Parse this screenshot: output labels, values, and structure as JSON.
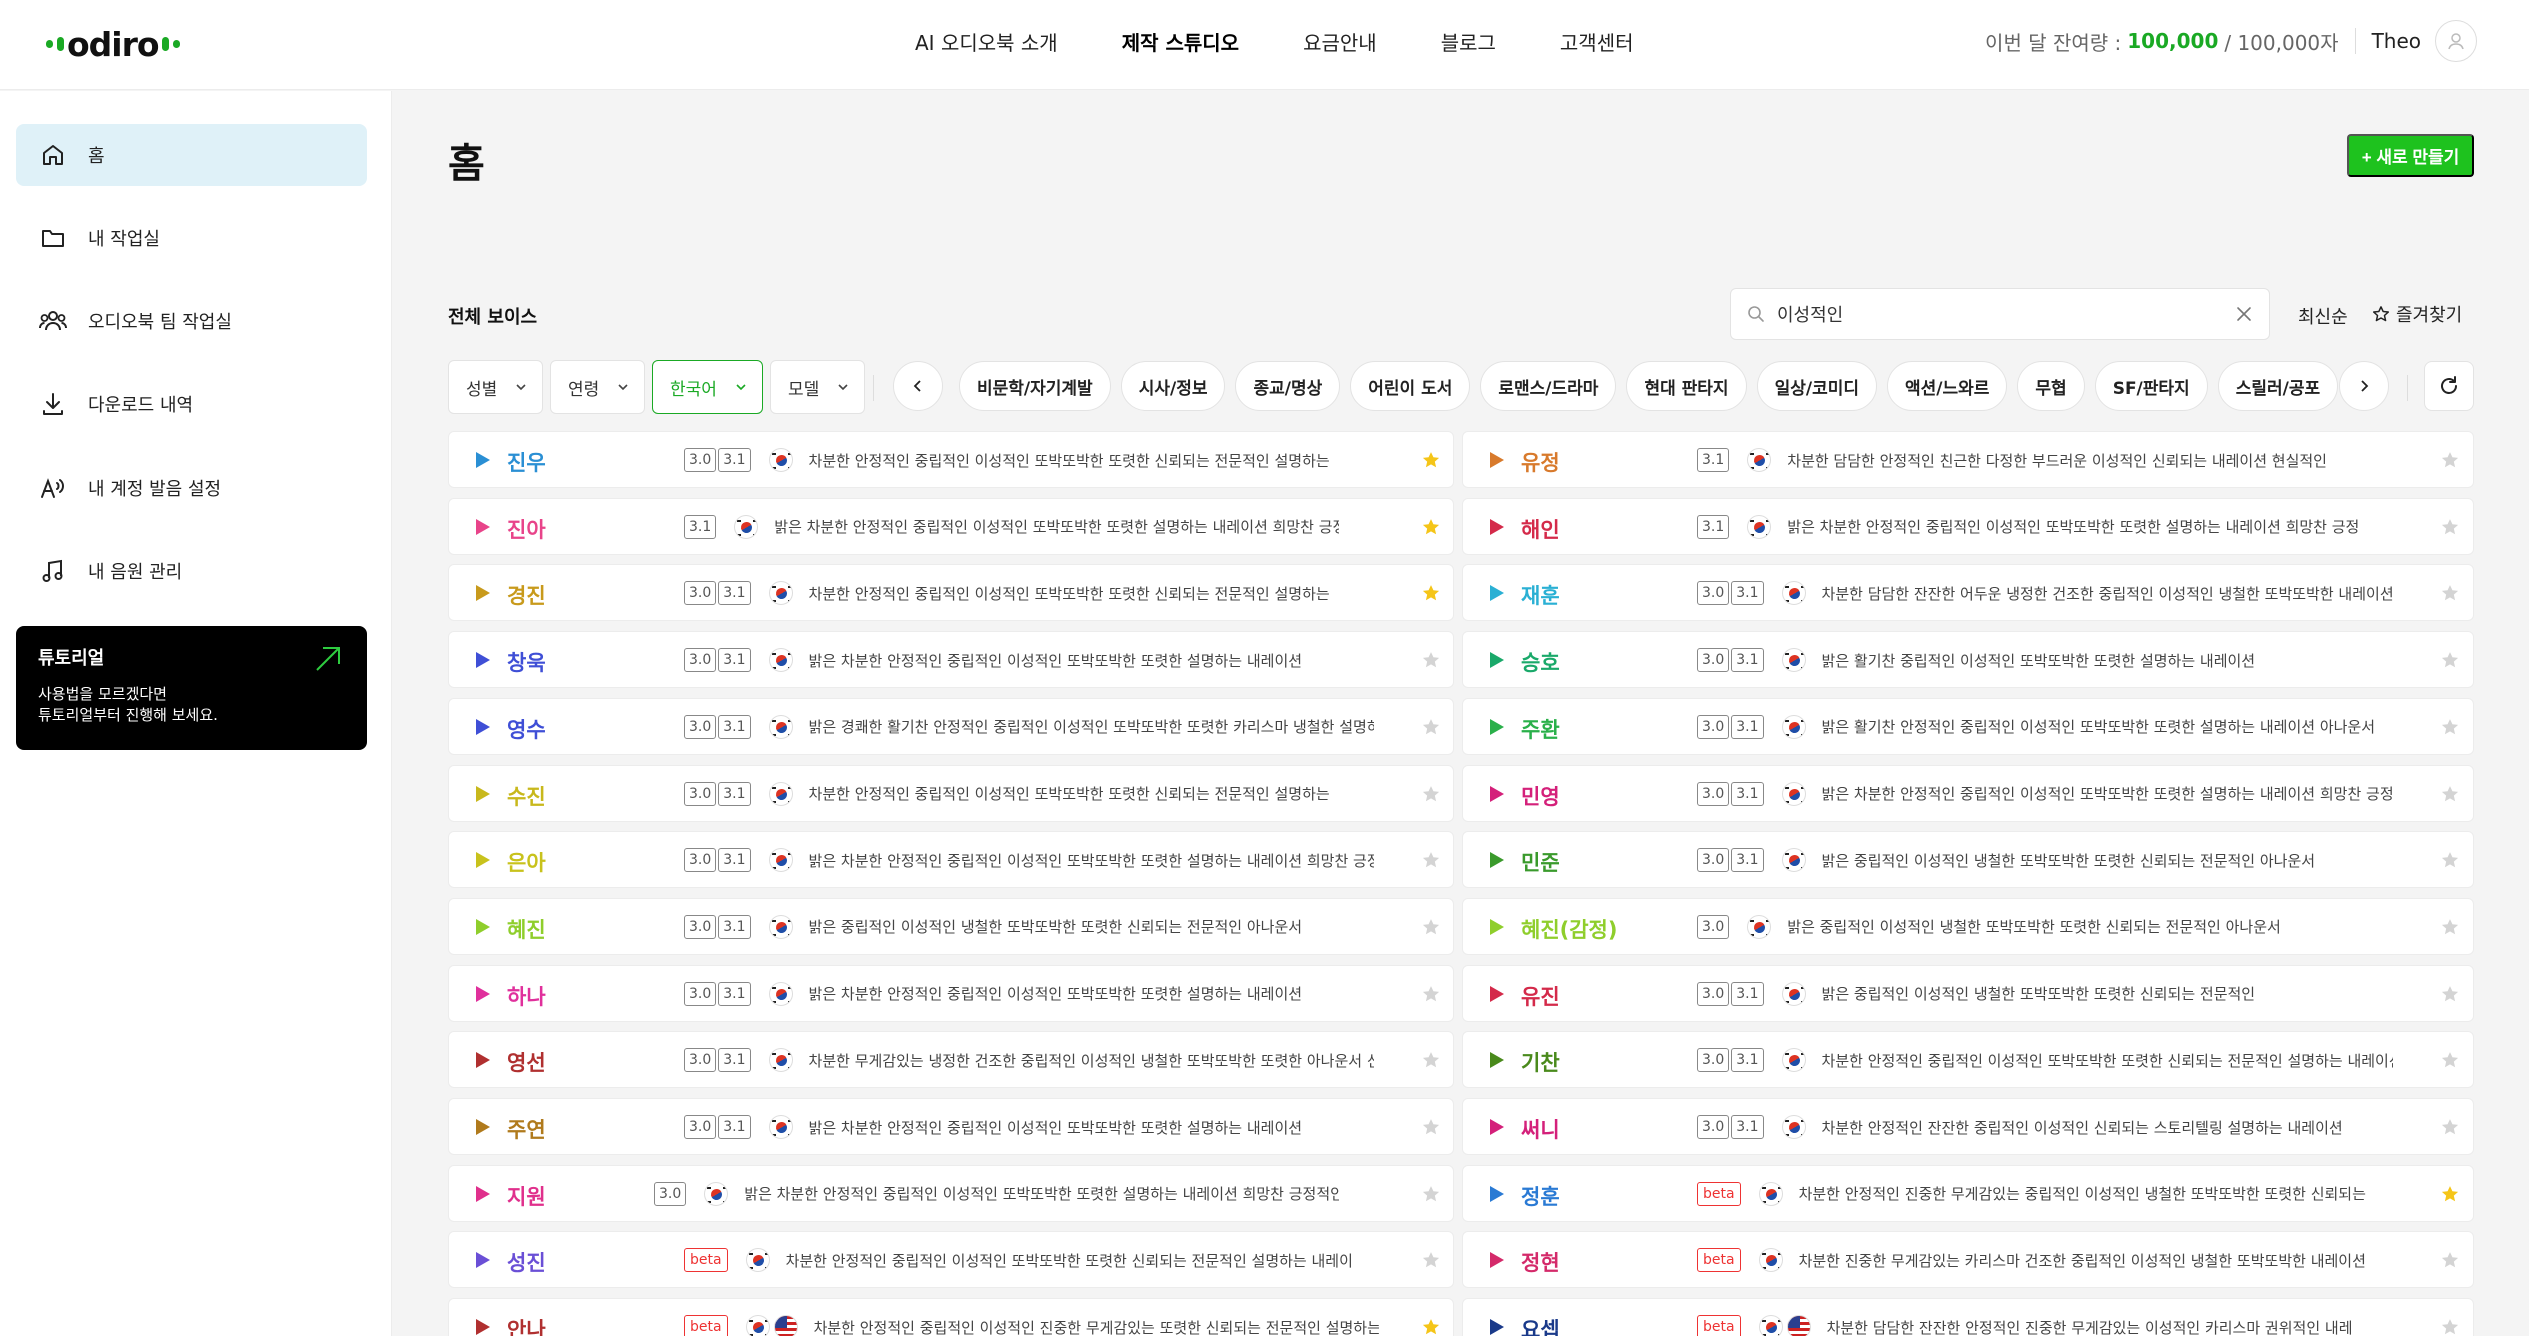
{
  "header": {
    "logo_text": "odiro",
    "nav": [
      "AI 오디오북 소개",
      "제작 스튜디오",
      "요금안내",
      "블로그",
      "고객센터"
    ],
    "active_nav": 1,
    "balance_label": "이번 달 잔여량 :",
    "balance_value": "100,000",
    "balance_total": "/ 100,000자",
    "user_name": "Theo"
  },
  "sidebar": {
    "items": [
      {
        "label": "홈",
        "icon": "home-icon",
        "active": true
      },
      {
        "label": "내 작업실",
        "icon": "folder-icon",
        "active": false
      },
      {
        "label": "오디오북 팀 작업실",
        "icon": "team-icon",
        "active": false
      },
      {
        "label": "다운로드 내역",
        "icon": "download-icon",
        "active": false
      },
      {
        "label": "내 계정 발음 설정",
        "icon": "pronunciation-icon",
        "active": false
      },
      {
        "label": "내 음원 관리",
        "icon": "music-note-icon",
        "active": false
      }
    ],
    "tutorial": {
      "title": "튜토리얼",
      "line1": "사용법을 모르겠다면",
      "line2": "튜토리얼부터 진행해 보세요."
    }
  },
  "main": {
    "title": "홈",
    "new_button": "+ 새로 만들기",
    "section_title": "전체 보이스",
    "search_value": "이성적인",
    "sort_label": "최신순",
    "favorites_label": "즐겨찾기",
    "filters": [
      {
        "label": "성별",
        "selected": false
      },
      {
        "label": "연령",
        "selected": false
      },
      {
        "label": "한국어",
        "selected": true
      },
      {
        "label": "모델",
        "selected": false
      }
    ],
    "categories": [
      "비문학/자기계발",
      "시사/정보",
      "종교/명상",
      "어린이 도서",
      "로맨스/드라마",
      "현대 판타지",
      "일상/코미디",
      "액션/느와르",
      "무협",
      "SF/판타지",
      "스릴러/공포"
    ]
  },
  "colors": {
    "accent_green": "#1ec21e",
    "sidebar_active": "#dff1f8",
    "star_on": "#f5c518",
    "star_off": "#d4d4d4",
    "beta_red": "#e33333"
  },
  "voices_left": [
    {
      "name": "진우",
      "color": "#2a8fd4",
      "badges": [
        "3.0",
        "3.1"
      ],
      "flags": [
        "kr"
      ],
      "tags": "차분한 안정적인 중립적인 이성적인 또박또박한 또렷한 신뢰되는 전문적인 설명하는",
      "fav": true
    },
    {
      "name": "진아",
      "color": "#e8448a",
      "badges": [
        "3.1"
      ],
      "flags": [
        "kr"
      ],
      "tags": "밝은 차분한 안정적인 중립적인 이성적인 또박또박한 또렷한 설명하는 내레이션 희망찬 긍정적인",
      "fav": true
    },
    {
      "name": "경진",
      "color": "#c89a1c",
      "badges": [
        "3.0",
        "3.1"
      ],
      "flags": [
        "kr"
      ],
      "tags": "차분한 안정적인 중립적인 이성적인 또박또박한 또렷한 신뢰되는 전문적인 설명하는",
      "fav": true
    },
    {
      "name": "창욱",
      "color": "#3f4fd6",
      "badges": [
        "3.0",
        "3.1"
      ],
      "flags": [
        "kr"
      ],
      "tags": "밝은 차분한 안정적인 중립적인 이성적인 또박또박한 또렷한 설명하는 내레이션",
      "fav": false
    },
    {
      "name": "영수",
      "color": "#3f4fd6",
      "badges": [
        "3.0",
        "3.1"
      ],
      "flags": [
        "kr"
      ],
      "tags": "밝은 경쾌한 활기찬 안정적인 중립적인 이성적인 또박또박한 또렷한 카리스마 냉철한 설명하는",
      "fav": false
    },
    {
      "name": "수진",
      "color": "#c8b81c",
      "badges": [
        "3.0",
        "3.1"
      ],
      "flags": [
        "kr"
      ],
      "tags": "차분한 안정적인 중립적인 이성적인 또박또박한 또렷한 신뢰되는 전문적인 설명하는",
      "fav": false
    },
    {
      "name": "은아",
      "color": "#c8c21c",
      "badges": [
        "3.0",
        "3.1"
      ],
      "flags": [
        "kr"
      ],
      "tags": "밝은 차분한 안정적인 중립적인 이성적인 또박또박한 또렷한 설명하는 내레이션 희망찬 긍정적",
      "fav": false
    },
    {
      "name": "혜진",
      "color": "#8fce2c",
      "badges": [
        "3.0",
        "3.1"
      ],
      "flags": [
        "kr"
      ],
      "tags": "밝은 중립적인 이성적인 냉철한 또박또박한 또렷한 신뢰되는 전문적인 아나운서",
      "fav": false
    },
    {
      "name": "하나",
      "color": "#e0309c",
      "badges": [
        "3.0",
        "3.1"
      ],
      "flags": [
        "kr"
      ],
      "tags": "밝은 차분한 안정적인 중립적인 이성적인 또박또박한 또렷한 설명하는 내레이션",
      "fav": false
    },
    {
      "name": "영선",
      "color": "#b03030",
      "badges": [
        "3.0",
        "3.1"
      ],
      "flags": [
        "kr"
      ],
      "tags": "차분한 무게감있는 냉정한 건조한 중립적인 이성적인 냉철한 또박또박한 또렷한 아나운서 신뢰",
      "fav": false
    },
    {
      "name": "주연",
      "color": "#b07a1c",
      "badges": [
        "3.0",
        "3.1"
      ],
      "flags": [
        "kr"
      ],
      "tags": "밝은 차분한 안정적인 중립적인 이성적인 또박또박한 또렷한 설명하는 내레이션",
      "fav": false
    },
    {
      "name": "지원",
      "color": "#e0308c",
      "badges": [
        "3.0"
      ],
      "flags": [
        "kr"
      ],
      "tags": "밝은 차분한 안정적인 중립적인 이성적인 또박또박한 또렷한 설명하는 내레이션 희망찬 긍정적인",
      "fav": false
    },
    {
      "name": "성진",
      "color": "#6a4fd6",
      "badges": [
        "beta"
      ],
      "flags": [
        "kr"
      ],
      "tags": "차분한 안정적인 중립적인 이성적인 또박또박한 또렷한 신뢰되는 전문적인 설명하는 내레이션 아",
      "fav": false
    },
    {
      "name": "안나",
      "color": "#b03030",
      "badges": [
        "beta"
      ],
      "flags": [
        "kr",
        "us"
      ],
      "tags": "차분한 안정적인 중립적인 이성적인 진중한 무게감있는 또렷한 신뢰되는 전문적인 설명하는 내레이션",
      "fav": true
    }
  ],
  "voices_right": [
    {
      "name": "유정",
      "color": "#d87a2c",
      "badges": [
        "3.1"
      ],
      "flags": [
        "kr"
      ],
      "tags": "차분한 담담한 안정적인 친근한 다정한 부드러운 이성적인 신뢰되는 내레이션 현실적인",
      "fav": false
    },
    {
      "name": "해인",
      "color": "#d42a4a",
      "badges": [
        "3.1"
      ],
      "flags": [
        "kr"
      ],
      "tags": "밝은 차분한 안정적인 중립적인 이성적인 또박또박한 또렷한 설명하는 내레이션 희망찬 긍정적인",
      "fav": false
    },
    {
      "name": "재훈",
      "color": "#2ab0d4",
      "badges": [
        "3.0",
        "3.1"
      ],
      "flags": [
        "kr"
      ],
      "tags": "차분한 담담한 잔잔한 어두운 냉정한 건조한 중립적인 이성적인 냉철한 또박또박한 내레이션 !",
      "fav": false
    },
    {
      "name": "승호",
      "color": "#1aa96a",
      "badges": [
        "3.0",
        "3.1"
      ],
      "flags": [
        "kr"
      ],
      "tags": "밝은 활기찬 중립적인 이성적인 또박또박한 또렷한 설명하는 내레이션",
      "fav": false
    },
    {
      "name": "주환",
      "color": "#2ab04a",
      "badges": [
        "3.0",
        "3.1"
      ],
      "flags": [
        "kr"
      ],
      "tags": "밝은 활기찬 안정적인 중립적인 이성적인 또박또박한 또렷한 설명하는 내레이션 아나운서",
      "fav": false
    },
    {
      "name": "민영",
      "color": "#d4207a",
      "badges": [
        "3.0",
        "3.1"
      ],
      "flags": [
        "kr"
      ],
      "tags": "밝은 차분한 안정적인 중립적인 이성적인 또박또박한 또렷한 설명하는 내레이션 희망찬 긍정적",
      "fav": false
    },
    {
      "name": "민준",
      "color": "#3a9a2c",
      "badges": [
        "3.0",
        "3.1"
      ],
      "flags": [
        "kr"
      ],
      "tags": "밝은 중립적인 이성적인 냉철한 또박또박한 또렷한 신뢰되는 전문적인 아나운서",
      "fav": false
    },
    {
      "name": "혜진(감정)",
      "color": "#8fce2c",
      "badges": [
        "3.0"
      ],
      "flags": [
        "kr"
      ],
      "tags": "밝은 중립적인 이성적인 냉철한 또박또박한 또렷한 신뢰되는 전문적인 아나운서",
      "fav": false
    },
    {
      "name": "유진",
      "color": "#d42a4a",
      "badges": [
        "3.0",
        "3.1"
      ],
      "flags": [
        "kr"
      ],
      "tags": "밝은 중립적인 이성적인 냉철한 또박또박한 또렷한 신뢰되는 전문적인",
      "fav": false
    },
    {
      "name": "기찬",
      "color": "#4a8a1c",
      "badges": [
        "3.0",
        "3.1"
      ],
      "flags": [
        "kr"
      ],
      "tags": "차분한 안정적인 중립적인 이성적인 또박또박한 또렷한 신뢰되는 전문적인 설명하는 내레이션",
      "fav": false
    },
    {
      "name": "써니",
      "color": "#d4207a",
      "badges": [
        "3.0",
        "3.1"
      ],
      "flags": [
        "kr"
      ],
      "tags": "차분한 안정적인 잔잔한 중립적인 이성적인 신뢰되는 스토리텔링 설명하는 내레이션",
      "fav": false
    },
    {
      "name": "정훈",
      "color": "#2a7ad4",
      "badges": [
        "beta"
      ],
      "flags": [
        "kr"
      ],
      "tags": "차분한 안정적인 진중한 무게감있는 중립적인 이성적인 냉철한 또박또박한 또렷한 신뢰되는 전문",
      "fav": true
    },
    {
      "name": "정현",
      "color": "#d42a6a",
      "badges": [
        "beta"
      ],
      "flags": [
        "kr"
      ],
      "tags": "차분한 진중한 무게감있는 카리스마 건조한 중립적인 이성적인 냉철한 또박또박한 내레이션 현실",
      "fav": false
    },
    {
      "name": "요셉",
      "color": "#1a3a8a",
      "badges": [
        "beta"
      ],
      "flags": [
        "kr",
        "us"
      ],
      "tags": "차분한 담담한 잔잔한 안정적인 진중한 무게감있는 이성적인 카리스마 권위적인 내레",
      "fav": false
    }
  ]
}
